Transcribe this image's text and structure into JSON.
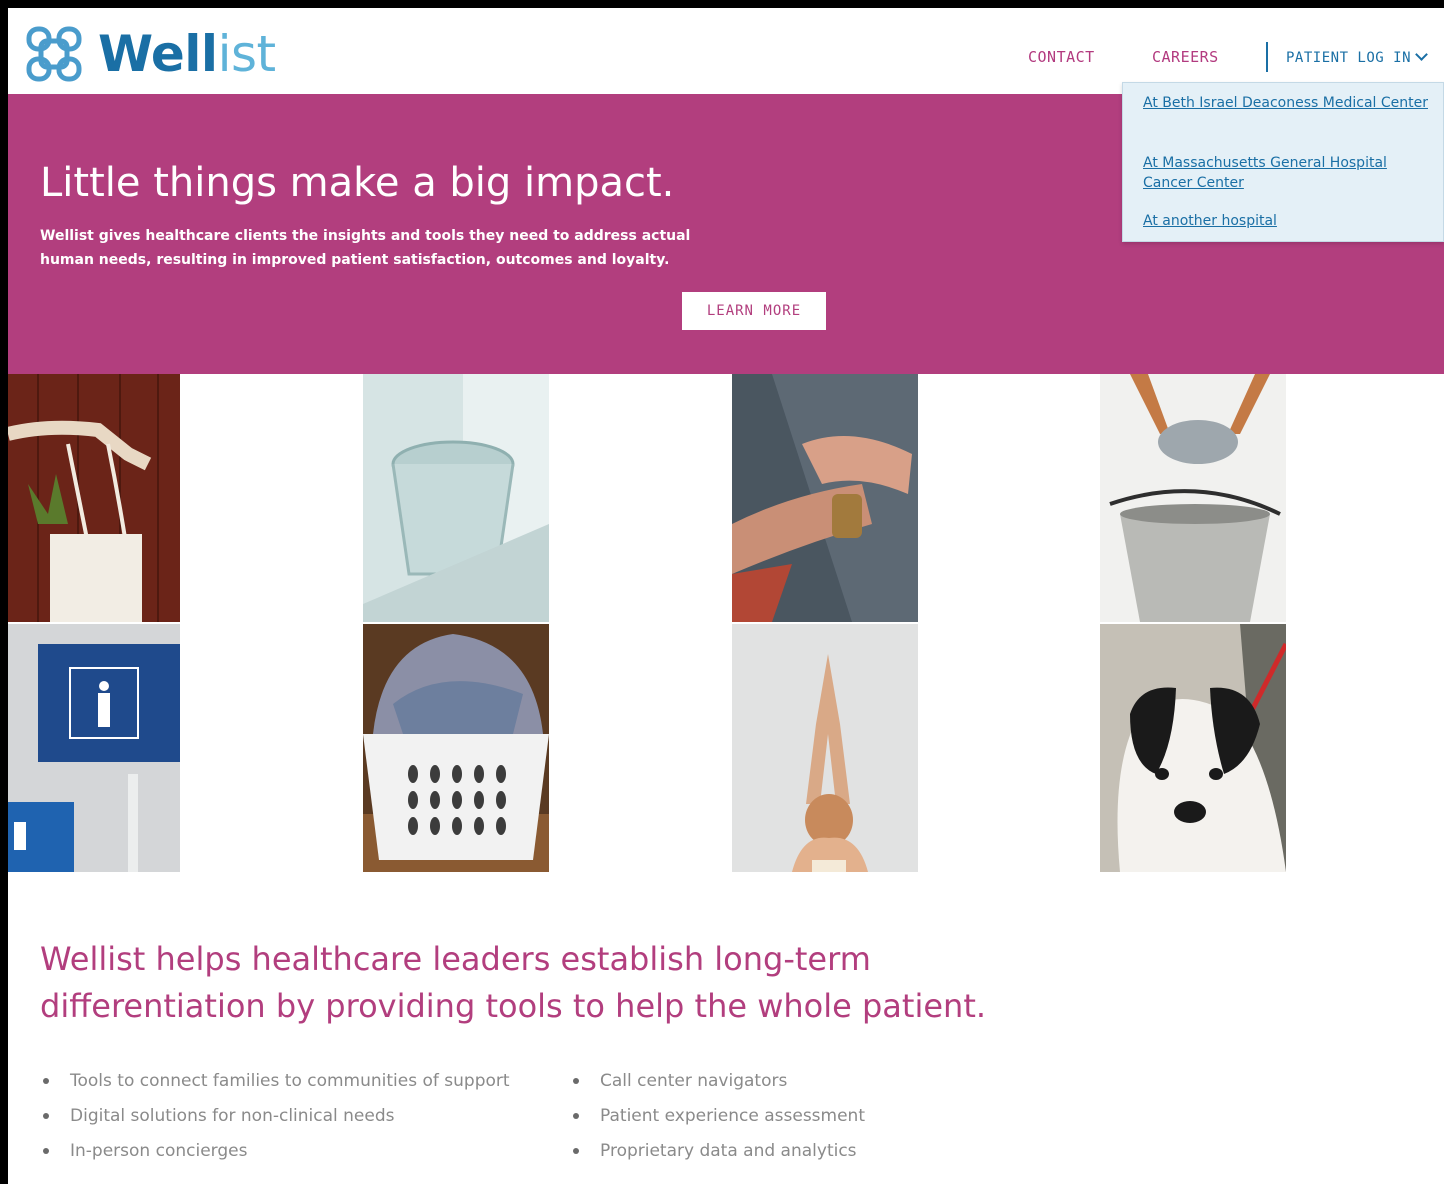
{
  "brand": {
    "name_part1": "Well",
    "name_part2": "ist",
    "color_primary": "#1a6fa5",
    "color_accent": "#b23e7e"
  },
  "nav": {
    "contact": "CONTACT",
    "careers": "CAREERS",
    "patient_login": "PATIENT LOG IN"
  },
  "login_menu": [
    {
      "label": "At Beth Israel Deaconess Medical Center"
    },
    {
      "label": "At Massachusetts General Hospital Cancer Center"
    },
    {
      "label": "At another hospital"
    }
  ],
  "hero": {
    "title": "Little things make a big impact.",
    "text": "Wellist gives healthcare clients the insights and tools they need to address actual human needs, resulting in improved patient satisfaction, outcomes and loyalty.",
    "cta": "LEARN MORE"
  },
  "photos": [
    {
      "icon": "tote-bag-icon"
    },
    {
      "icon": "water-glass-icon"
    },
    {
      "icon": "wristwatch-icon"
    },
    {
      "icon": "bucket-icon"
    },
    {
      "icon": "restroom-sign-icon"
    },
    {
      "icon": "laundry-basket-icon"
    },
    {
      "icon": "yoga-icon"
    },
    {
      "icon": "dog-icon"
    }
  ],
  "lead": "Wellist helps healthcare leaders establish long-term differentiation by providing tools to help the whole patient.",
  "features_left": [
    "Tools to connect families to communities of support",
    "Digital solutions for non-clinical needs",
    "In-person concierges"
  ],
  "features_right": [
    "Call center navigators",
    "Patient experience assessment",
    "Proprietary data and analytics"
  ]
}
